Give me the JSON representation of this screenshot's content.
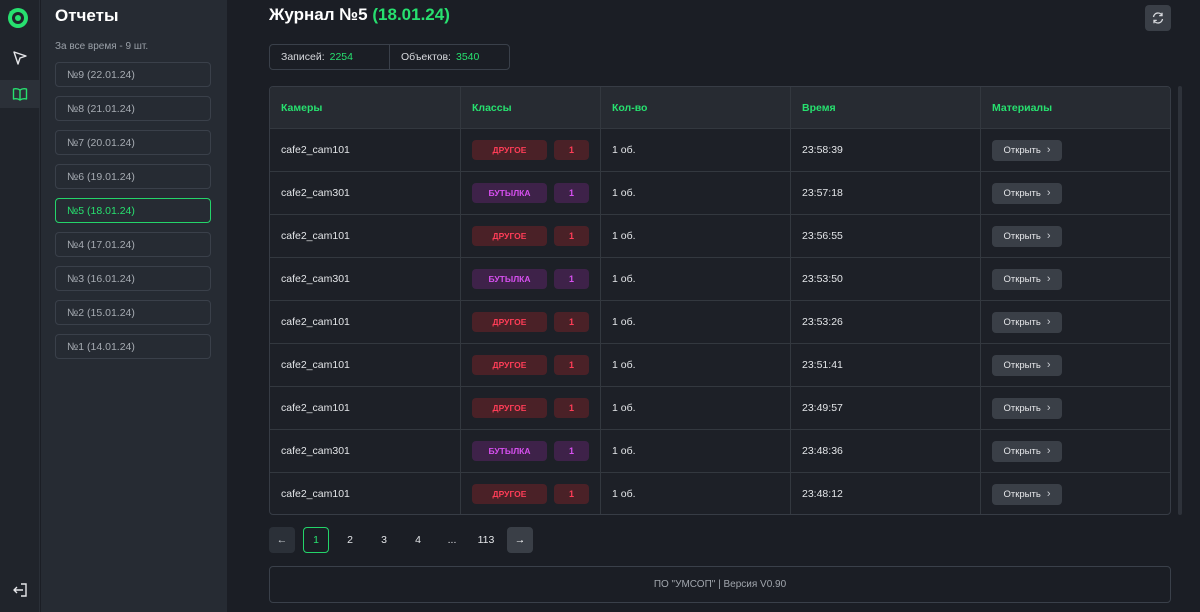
{
  "sidebar": {
    "title": "Отчеты",
    "subtitle": "За все время - 9 шт.",
    "reports": [
      {
        "label": "№9 (22.01.24)",
        "active": false
      },
      {
        "label": "№8 (21.01.24)",
        "active": false
      },
      {
        "label": "№7 (20.01.24)",
        "active": false
      },
      {
        "label": "№6 (19.01.24)",
        "active": false
      },
      {
        "label": "№5 (18.01.24)",
        "active": true
      },
      {
        "label": "№4 (17.01.24)",
        "active": false
      },
      {
        "label": "№3 (16.01.24)",
        "active": false
      },
      {
        "label": "№2 (15.01.24)",
        "active": false
      },
      {
        "label": "№1 (14.01.24)",
        "active": false
      }
    ]
  },
  "rail": {
    "icons": [
      "logo-icon",
      "send-icon",
      "book-icon",
      "logout-icon"
    ]
  },
  "header": {
    "title": "Журнал №5",
    "date": "(18.01.24)"
  },
  "stats": {
    "records_label": "Записей:",
    "records_value": "2254",
    "objects_label": "Объектов:",
    "objects_value": "3540"
  },
  "table": {
    "columns": [
      "Камеры",
      "Классы",
      "Кол-во",
      "Время",
      "Материалы"
    ],
    "rows": [
      {
        "camera": "cafe2_cam101",
        "class": "ДРУГОЕ",
        "kind": "other",
        "count": "1",
        "qty": "1 об.",
        "time": "23:58:39",
        "action": "Открыть"
      },
      {
        "camera": "cafe2_cam301",
        "class": "БУТЫЛКА",
        "kind": "bottle",
        "count": "1",
        "qty": "1 об.",
        "time": "23:57:18",
        "action": "Открыть"
      },
      {
        "camera": "cafe2_cam101",
        "class": "ДРУГОЕ",
        "kind": "other",
        "count": "1",
        "qty": "1 об.",
        "time": "23:56:55",
        "action": "Открыть"
      },
      {
        "camera": "cafe2_cam301",
        "class": "БУТЫЛКА",
        "kind": "bottle",
        "count": "1",
        "qty": "1 об.",
        "time": "23:53:50",
        "action": "Открыть"
      },
      {
        "camera": "cafe2_cam101",
        "class": "ДРУГОЕ",
        "kind": "other",
        "count": "1",
        "qty": "1 об.",
        "time": "23:53:26",
        "action": "Открыть"
      },
      {
        "camera": "cafe2_cam101",
        "class": "ДРУГОЕ",
        "kind": "other",
        "count": "1",
        "qty": "1 об.",
        "time": "23:51:41",
        "action": "Открыть"
      },
      {
        "camera": "cafe2_cam101",
        "class": "ДРУГОЕ",
        "kind": "other",
        "count": "1",
        "qty": "1 об.",
        "time": "23:49:57",
        "action": "Открыть"
      },
      {
        "camera": "cafe2_cam301",
        "class": "БУТЫЛКА",
        "kind": "bottle",
        "count": "1",
        "qty": "1 об.",
        "time": "23:48:36",
        "action": "Открыть"
      },
      {
        "camera": "cafe2_cam101",
        "class": "ДРУГОЕ",
        "kind": "other",
        "count": "1",
        "qty": "1 об.",
        "time": "23:48:12",
        "action": "Открыть"
      }
    ]
  },
  "pagination": {
    "prev": "←",
    "next": "→",
    "pages": [
      "1",
      "2",
      "3",
      "4",
      "...",
      "113"
    ],
    "current": "1"
  },
  "footer": {
    "text": "ПО \"УМСОП\" | Версия V0.90"
  },
  "colors": {
    "accent": "#27e06f",
    "other_badge": "#ff3d57",
    "bottle_badge": "#d750f0",
    "background": "#1b1e25"
  }
}
